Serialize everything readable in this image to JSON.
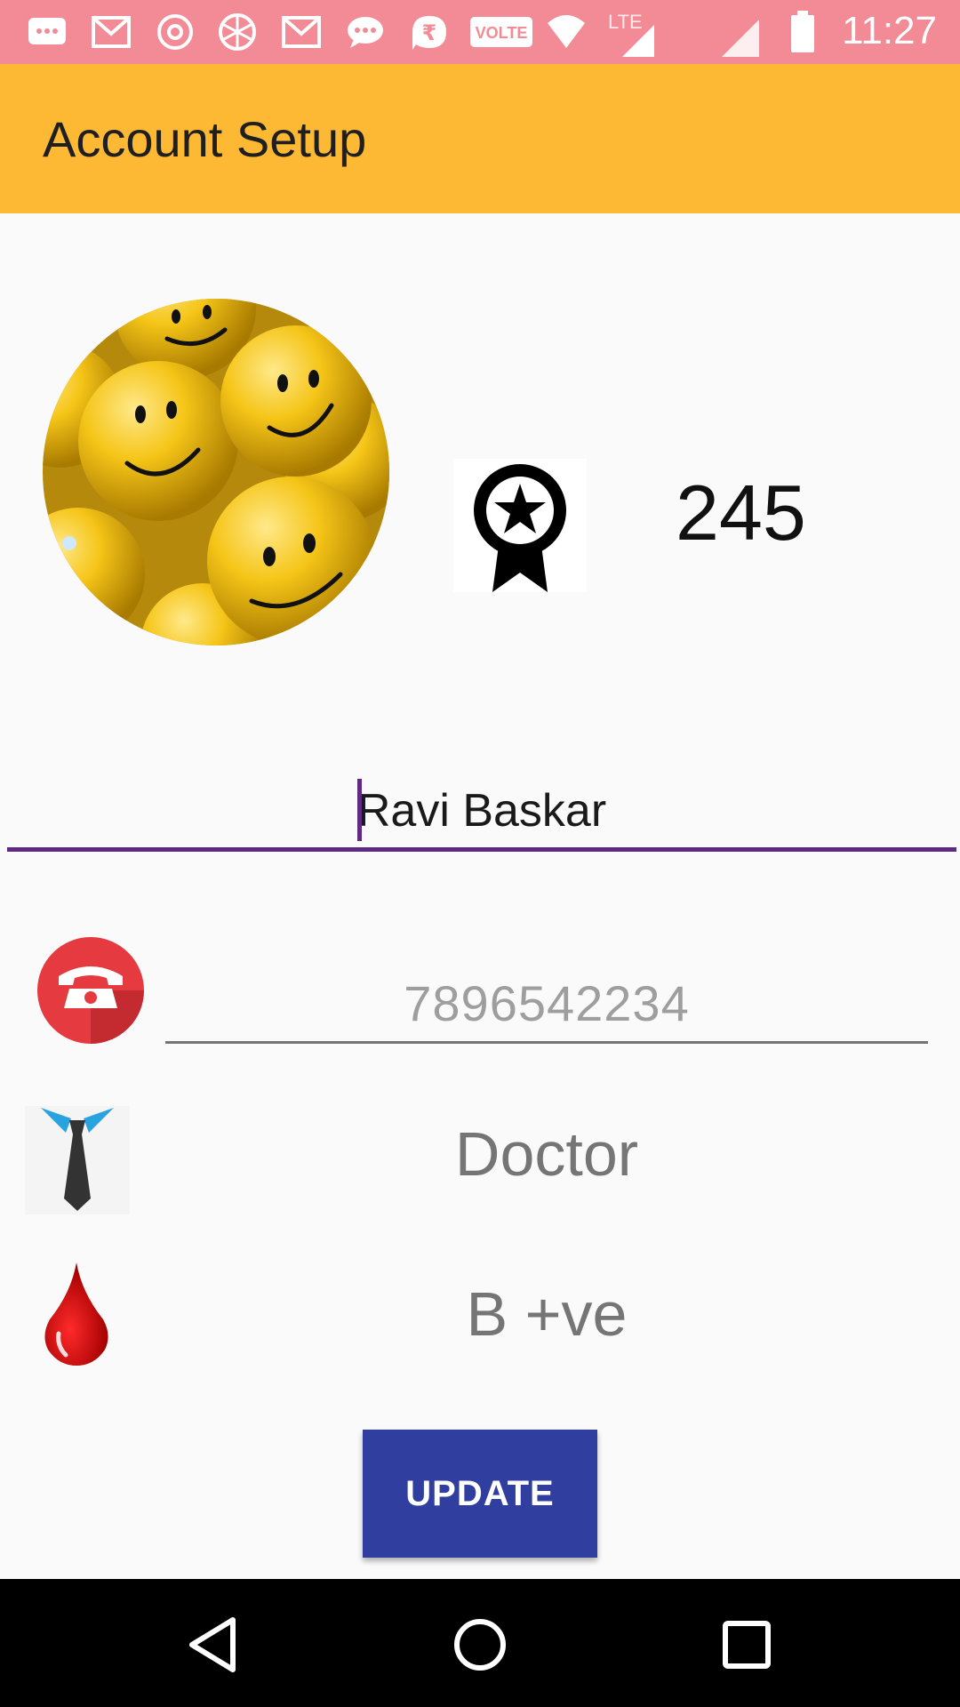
{
  "status_bar": {
    "time": "11:27",
    "icons": [
      "message-icon",
      "gmail-icon",
      "chrome-icon",
      "app-icon",
      "gmail-icon",
      "chat-icon",
      "rupee-icon",
      "volte-icon",
      "wifi-icon",
      "lte-signal-icon",
      "signal-icon",
      "battery-icon"
    ],
    "volte_label": "VOLTE",
    "lte_label": "LTE"
  },
  "app_bar": {
    "title": "Account Setup",
    "background": "#fdb934"
  },
  "profile": {
    "points": "245",
    "avatar_icon": "smiley-avatar",
    "badge_icon": "award-ribbon-icon"
  },
  "form": {
    "name_value": "Ravi Baskar",
    "phone_value": "7896542234",
    "occupation": "Doctor",
    "blood_group": "B +ve",
    "accent": "#5e2a83"
  },
  "actions": {
    "update_label": "UPDATE",
    "update_color": "#303f9f"
  },
  "nav_bar": {
    "items": [
      "back-icon",
      "home-icon",
      "recents-icon"
    ]
  }
}
